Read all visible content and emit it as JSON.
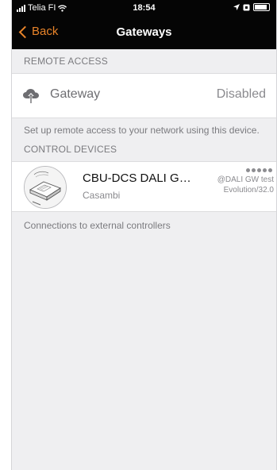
{
  "status_bar": {
    "carrier": "Telia FI",
    "time": "18:54"
  },
  "nav": {
    "back_label": "Back",
    "title": "Gateways"
  },
  "remote_access": {
    "header": "REMOTE ACCESS",
    "gateway_label": "Gateway",
    "gateway_status": "Disabled",
    "footer": "Set up remote access to your network using this device."
  },
  "control_devices": {
    "header": "CONTROL DEVICES",
    "items": [
      {
        "name": "CBU-DCS DALI Gateway",
        "vendor": "Casambi",
        "signal_dots": 5,
        "network": "@DALI GW test",
        "firmware": "Evolution/32.0"
      }
    ],
    "footer": "Connections to external controllers"
  },
  "colors": {
    "accent": "#e8842a",
    "nav_background": "#050505",
    "page_background": "#efeff1"
  },
  "icons": {
    "back": "chevron-left-icon",
    "gateway": "cloud-upload-icon",
    "signal": "signal-dots-icon"
  }
}
